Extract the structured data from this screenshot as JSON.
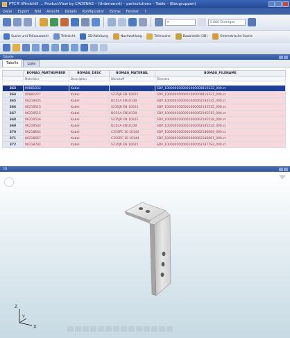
{
  "window": {
    "title": "PTC® Windchill ... ProductView by CADENAS – (Unbenannt) – partsolutions – Table – (Baugruppen)"
  },
  "menu": [
    "Datei",
    "Export",
    "Bild",
    "Ansicht",
    "Details",
    "Konfigurator",
    "Extras",
    "Fenster",
    "?"
  ],
  "toolbar2": {
    "buttons": [
      "Suche und Teileauswahl",
      "Teilesicht",
      "3D-Ableitung",
      "Nachwahlung",
      "Teilesuche",
      "Bauanteile (3D)",
      "Geometrische Suche"
    ],
    "dropdown": "5.000 Einträgen"
  },
  "panels": {
    "top_title": "Tabelle",
    "bottom_title": "3D"
  },
  "tabs": [
    "Tabelle",
    "Liste"
  ],
  "table": {
    "headers": [
      "BOMAG_PARTNUMBER",
      "BOMAG_DESC",
      "BOMAG_MATERIAL",
      "BOMAG_FILENAME"
    ],
    "subheaders": [
      "Materialnr.",
      "Description",
      "Werkstoff",
      "Filename"
    ],
    "rows": [
      {
        "num": "363",
        "partnumber": "09881032",
        "desc": "Kabel",
        "material": "",
        "filename": "SDP_1000001000001000008810332_000.st"
      },
      {
        "num": "364",
        "partnumber": "09881227",
        "desc": "Kabel",
        "material": "S235JR EN 10025",
        "filename": "SDP_1000001000001000008810227_000.st"
      },
      {
        "num": "365",
        "partnumber": "06219435",
        "desc": "Kabel",
        "material": "DC01A EN10130",
        "filename": "SDP_1000001000001000062194335_000.st"
      },
      {
        "num": "366",
        "partnumber": "06219515",
        "desc": "Kabel",
        "material": "S235JR EN 10025",
        "filename": "SDP_1000001000001000062195515_000.st"
      },
      {
        "num": "367",
        "partnumber": "06219515",
        "desc": "Kabel",
        "material": "DC01A EN10130",
        "filename": "SDP_1000001000001000062195515_000.st"
      },
      {
        "num": "368",
        "partnumber": "06219528",
        "desc": "Kabel",
        "material": "S235JR EN 10025",
        "filename": "SDP_1000001000001000062195528_000.st"
      },
      {
        "num": "369",
        "partnumber": "06219532",
        "desc": "Kabel",
        "material": "DC01A EN10130",
        "filename": "SDP_1000001000001000062195532_000.st"
      },
      {
        "num": "370",
        "partnumber": "06218664",
        "desc": "Kabel",
        "material": "C35SPC 10 10144",
        "filename": "SDP_1000001000001000062186664_000.st"
      },
      {
        "num": "371",
        "partnumber": "06218667",
        "desc": "Kabel",
        "material": "C35SPC 10 10144",
        "filename": "SDP_1000001000001000062186667_000.st"
      },
      {
        "num": "372",
        "partnumber": "06218782",
        "desc": "Kabel",
        "material": "S235JR EN 10025",
        "filename": "SDP_1000001000001000062187782_000.st"
      }
    ]
  },
  "viewport": {
    "axis_labels": [
      "Z",
      "Y",
      "X"
    ]
  }
}
